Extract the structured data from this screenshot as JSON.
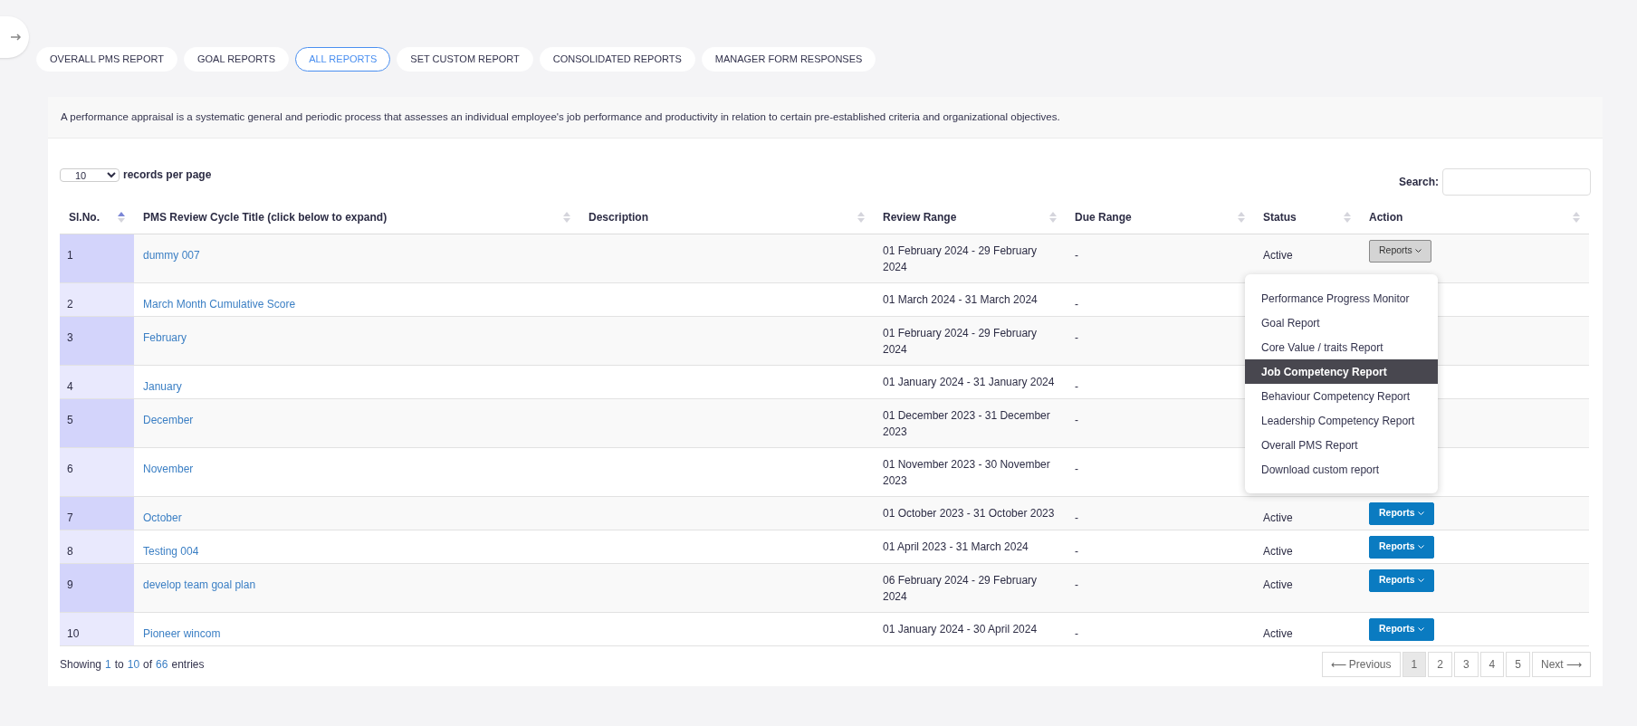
{
  "tabs": [
    {
      "label": "OVERALL PMS REPORT",
      "selected": false
    },
    {
      "label": "GOAL REPORTS",
      "selected": false
    },
    {
      "label": "ALL REPORTS",
      "selected": true
    },
    {
      "label": "SET CUSTOM REPORT",
      "selected": false
    },
    {
      "label": "CONSOLIDATED REPORTS",
      "selected": false
    },
    {
      "label": "MANAGER FORM RESPONSES",
      "selected": false
    }
  ],
  "description": "A performance appraisal is a systematic general and periodic process that assesses an individual employee's job performance and productivity in relation to certain pre-established criteria and organizational objectives.",
  "page_size": {
    "value": "10",
    "label": "records per page"
  },
  "search": {
    "label": "Search:"
  },
  "table": {
    "columns": [
      {
        "label": "Sl.No.",
        "sorted": true
      },
      {
        "label": "PMS Review Cycle Title (click below to expand)",
        "sorted": false
      },
      {
        "label": "Description",
        "sorted": false
      },
      {
        "label": "Review Range",
        "sorted": false
      },
      {
        "label": "Due Range",
        "sorted": false
      },
      {
        "label": "Status",
        "sorted": false
      },
      {
        "label": "Action",
        "sorted": false
      }
    ],
    "rows": [
      {
        "no": "1",
        "title": "dummy 007",
        "review": "01 February 2024 - 29 February 2024",
        "due": "-",
        "status": "Active",
        "action": "Reports",
        "open": true
      },
      {
        "no": "2",
        "title": "March Month Cumulative Score",
        "review": "01 March 2024 - 31 March 2024",
        "due": "-"
      },
      {
        "no": "3",
        "title": "February",
        "review": "01 February 2024 - 29 February 2024",
        "due": "-"
      },
      {
        "no": "4",
        "title": "January",
        "review": "01 January 2024 - 31 January 2024",
        "due": "-"
      },
      {
        "no": "5",
        "title": "December",
        "review": "01 December 2023 - 31 December 2023",
        "due": "-"
      },
      {
        "no": "6",
        "title": "November",
        "review": "01 November 2023 - 30 November 2023",
        "due": "-"
      },
      {
        "no": "7",
        "title": "October",
        "review": "01 October 2023 - 31 October 2023",
        "due": "-",
        "status": "Active",
        "action": "Reports",
        "open": false
      },
      {
        "no": "8",
        "title": "Testing 004",
        "review": "01 April 2023 - 31 March 2024",
        "due": "-",
        "status": "Active",
        "action": "Reports",
        "open": false
      },
      {
        "no": "9",
        "title": "develop team goal plan",
        "review": "06 February 2024 - 29 February 2024",
        "due": "-",
        "status": "Active",
        "action": "Reports",
        "open": false
      },
      {
        "no": "10",
        "title": "Pioneer wincom",
        "review": "01 January 2024 - 30 April 2024",
        "due": "-",
        "status": "Active",
        "action": "Reports",
        "open": false
      }
    ]
  },
  "menu": {
    "items": [
      {
        "label": "Performance Progress Monitor",
        "selected": false
      },
      {
        "label": "Goal Report",
        "selected": false
      },
      {
        "label": "Core Value / traits Report",
        "selected": false
      },
      {
        "label": "Job Competency Report",
        "selected": true
      },
      {
        "label": "Behaviour Competency Report",
        "selected": false
      },
      {
        "label": "Leadership Competency Report",
        "selected": false
      },
      {
        "label": "Overall PMS Report",
        "selected": false
      },
      {
        "label": "Download custom report",
        "selected": false
      }
    ]
  },
  "info": [
    {
      "text": "Showing",
      "highlight": false
    },
    {
      "text": "1",
      "highlight": true
    },
    {
      "text": "to",
      "highlight": false
    },
    {
      "text": "10",
      "highlight": true
    },
    {
      "text": "of",
      "highlight": false
    },
    {
      "text": "66",
      "highlight": true
    },
    {
      "text": "entries",
      "highlight": false
    }
  ],
  "pagination": [
    {
      "label": "⟵ Previous",
      "selected": false
    },
    {
      "label": "1",
      "selected": true
    },
    {
      "label": "2",
      "selected": false
    },
    {
      "label": "3",
      "selected": false
    },
    {
      "label": "4",
      "selected": false
    },
    {
      "label": "5",
      "selected": false
    },
    {
      "label": "Next ⟶",
      "selected": false
    }
  ]
}
